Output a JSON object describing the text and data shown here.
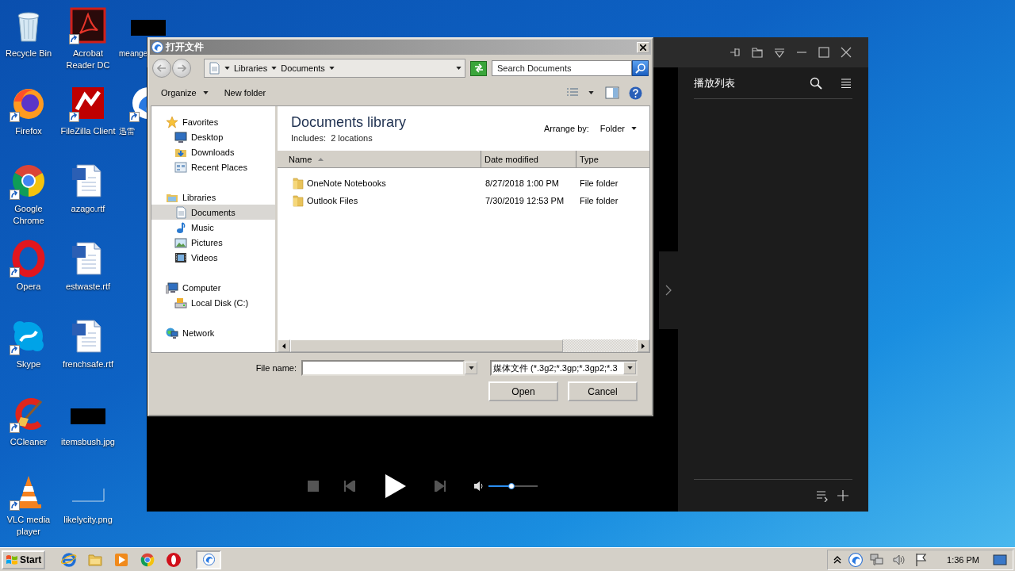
{
  "desktop": {
    "columns": [
      [
        {
          "label": "Recycle Bin",
          "kind": "recycle",
          "shortcut": false
        },
        {
          "label": "Firefox",
          "kind": "firefox",
          "shortcut": true
        },
        {
          "label": "Google Chrome",
          "kind": "chrome",
          "shortcut": true
        },
        {
          "label": "Opera",
          "kind": "opera",
          "shortcut": true
        },
        {
          "label": "Skype",
          "kind": "skype",
          "shortcut": true
        },
        {
          "label": "CCleaner",
          "kind": "ccleaner",
          "shortcut": true
        },
        {
          "label": "VLC media player",
          "kind": "vlc",
          "shortcut": true
        }
      ],
      [
        {
          "label": "Acrobat Reader DC",
          "kind": "acrobat",
          "shortcut": true
        },
        {
          "label": "FileZilla Client",
          "kind": "filezilla",
          "shortcut": true
        },
        {
          "label": "azago.rtf",
          "kind": "document",
          "shortcut": false
        },
        {
          "label": "estwaste.rtf",
          "kind": "document",
          "shortcut": false
        },
        {
          "label": "frenchsafe.rtf",
          "kind": "document",
          "shortcut": false
        },
        {
          "label": "itemsbush.jpg",
          "kind": "image-dark",
          "shortcut": false
        },
        {
          "label": "likelycity.png",
          "kind": "image-blank",
          "shortcut": false
        }
      ],
      [
        {
          "label": "meange",
          "kind": "image-dark",
          "shortcut": false
        },
        {
          "label": "迅雷",
          "kind": "xunlei",
          "shortcut": true
        }
      ]
    ]
  },
  "player": {
    "playlist_title": "播放列表",
    "volume": {
      "level": 0.48
    }
  },
  "open_dialog": {
    "title": "打开文件",
    "breadcrumb": [
      "Libraries",
      "Documents"
    ],
    "search": {
      "placeholder": "Search Documents"
    },
    "toolbar": [
      {
        "label": "Organize",
        "kind": "menu"
      },
      {
        "label": "New folder",
        "kind": "button"
      }
    ],
    "nav": [
      {
        "label": "Favorites",
        "kind": "favorites",
        "selected": false,
        "children": [
          {
            "label": "Desktop",
            "kind": "desktop",
            "selected": false
          },
          {
            "label": "Downloads",
            "kind": "downloads",
            "selected": false
          },
          {
            "label": "Recent Places",
            "kind": "recent",
            "selected": false
          }
        ]
      },
      {
        "label": "Libraries",
        "kind": "libraries",
        "selected": false,
        "children": [
          {
            "label": "Documents",
            "kind": "documents",
            "selected": true
          },
          {
            "label": "Music",
            "kind": "music",
            "selected": false
          },
          {
            "label": "Pictures",
            "kind": "pictures",
            "selected": false
          },
          {
            "label": "Videos",
            "kind": "videos",
            "selected": false
          }
        ]
      },
      {
        "label": "Computer",
        "kind": "computer",
        "selected": false,
        "children": [
          {
            "label": "Local Disk (C:)",
            "kind": "disk",
            "selected": false
          }
        ]
      },
      {
        "label": "Network",
        "kind": "network",
        "selected": false
      }
    ],
    "library": {
      "title": "Documents library",
      "subtitle": "Includes:  2 locations",
      "arrange_label": "Arrange by:",
      "arrange_value": "Folder"
    },
    "table": {
      "columns": [
        {
          "label": "Name",
          "sorted": true
        },
        {
          "label": "Date modified",
          "sorted": false
        },
        {
          "label": "Type",
          "sorted": false
        }
      ],
      "rows": [
        {
          "cells": [
            "OneNote Notebooks",
            "8/27/2018 1:00 PM",
            "File folder"
          ],
          "selected": false
        },
        {
          "cells": [
            "Outlook Files",
            "7/30/2019 12:53 PM",
            "File folder"
          ],
          "selected": false
        }
      ]
    },
    "file_name": {
      "label": "File name:"
    },
    "file_type": {
      "value": "媒体文件 (*.3g2;*.3gp;*.3gp2;*.3"
    },
    "buttons": [
      "Open",
      "Cancel"
    ]
  },
  "taskbar": {
    "start_label": "Start",
    "tasks": [
      {
        "selected": true
      }
    ],
    "clock": "1:36 PM"
  }
}
